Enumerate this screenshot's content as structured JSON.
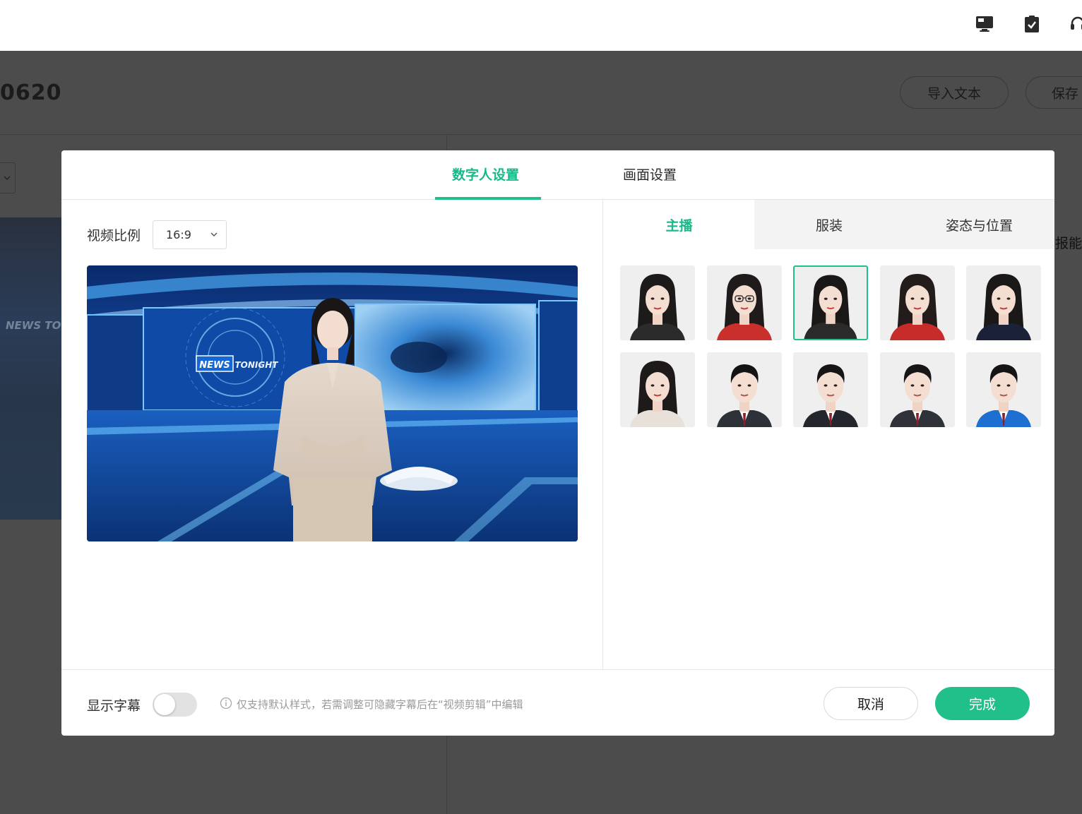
{
  "background": {
    "title_fragment": "0620",
    "import_button": "导入文本",
    "save_button": "保存",
    "side_text": "报能",
    "thumbnail_tag": "NEWS TO"
  },
  "modal": {
    "tabs": [
      {
        "label": "数字人设置",
        "active": true
      },
      {
        "label": "画面设置",
        "active": false
      }
    ],
    "ratio_label": "视频比例",
    "ratio_value": "16:9",
    "preview": {
      "logo_word1": "NEWS",
      "logo_word2": "TONIGHT"
    },
    "sub_tabs": [
      {
        "label": "主播",
        "active": true
      },
      {
        "label": "服装",
        "active": false
      },
      {
        "label": "姿态与位置",
        "active": false
      }
    ],
    "avatars": [
      {
        "gender": "female",
        "hair": "#1d1a1a",
        "outfit": "#2b2b2b",
        "selected": false,
        "glasses": false
      },
      {
        "gender": "female",
        "hair": "#1f1b1b",
        "outfit": "#c9302b",
        "selected": false,
        "glasses": true
      },
      {
        "gender": "female",
        "hair": "#1a1717",
        "outfit": "#2a2a2a",
        "selected": true,
        "glasses": false
      },
      {
        "gender": "female",
        "hair": "#231c1a",
        "outfit": "#c82c2a",
        "selected": false,
        "glasses": false
      },
      {
        "gender": "female",
        "hair": "#1b1818",
        "outfit": "#1b2238",
        "selected": false,
        "glasses": false
      },
      {
        "gender": "female",
        "hair": "#1e1a1a",
        "outfit": "#e7e1da",
        "selected": false,
        "glasses": false
      },
      {
        "gender": "male",
        "hair": "#141212",
        "outfit": "#2d3138",
        "selected": false,
        "glasses": false
      },
      {
        "gender": "male",
        "hair": "#161414",
        "outfit": "#23262c",
        "selected": false,
        "glasses": false
      },
      {
        "gender": "male",
        "hair": "#171515",
        "outfit": "#2f3238",
        "selected": false,
        "glasses": false
      },
      {
        "gender": "male",
        "hair": "#151313",
        "outfit": "#1d6fd1",
        "selected": false,
        "glasses": false
      }
    ],
    "footer": {
      "subtitle_label": "显示字幕",
      "subtitle_enabled": false,
      "hint": "仅支持默认样式，若需调整可隐藏字幕后在“视频剪辑”中编辑",
      "cancel": "取消",
      "done": "完成"
    }
  },
  "colors": {
    "accent": "#21c08b",
    "overlay": "#4c4c4c"
  },
  "icons": [
    "monitor-icon",
    "clipboard-check-icon",
    "headset-icon",
    "chevron-down-icon",
    "info-icon"
  ]
}
